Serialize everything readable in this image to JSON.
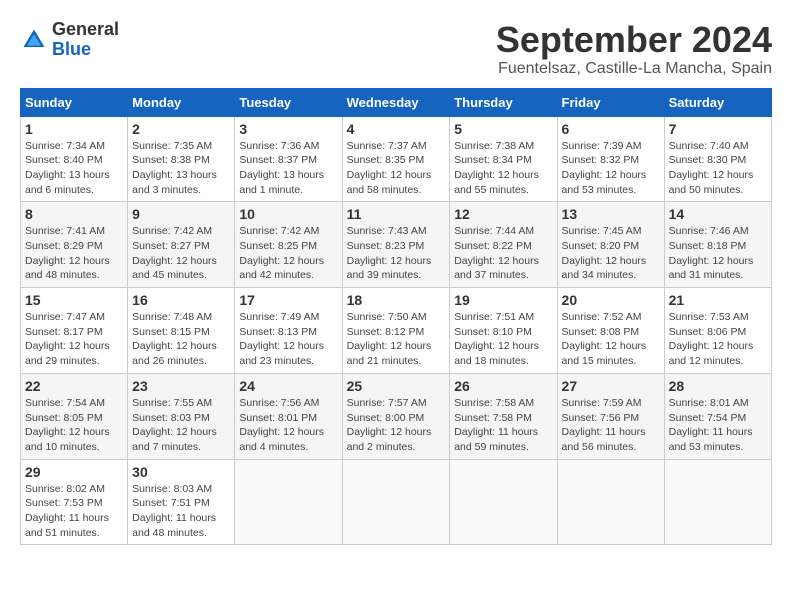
{
  "header": {
    "logo_general": "General",
    "logo_blue": "Blue",
    "month": "September 2024",
    "location": "Fuentelsaz, Castille-La Mancha, Spain"
  },
  "weekdays": [
    "Sunday",
    "Monday",
    "Tuesday",
    "Wednesday",
    "Thursday",
    "Friday",
    "Saturday"
  ],
  "weeks": [
    [
      {
        "day": "1",
        "info": "Sunrise: 7:34 AM\nSunset: 8:40 PM\nDaylight: 13 hours\nand 6 minutes."
      },
      {
        "day": "2",
        "info": "Sunrise: 7:35 AM\nSunset: 8:38 PM\nDaylight: 13 hours\nand 3 minutes."
      },
      {
        "day": "3",
        "info": "Sunrise: 7:36 AM\nSunset: 8:37 PM\nDaylight: 13 hours\nand 1 minute."
      },
      {
        "day": "4",
        "info": "Sunrise: 7:37 AM\nSunset: 8:35 PM\nDaylight: 12 hours\nand 58 minutes."
      },
      {
        "day": "5",
        "info": "Sunrise: 7:38 AM\nSunset: 8:34 PM\nDaylight: 12 hours\nand 55 minutes."
      },
      {
        "day": "6",
        "info": "Sunrise: 7:39 AM\nSunset: 8:32 PM\nDaylight: 12 hours\nand 53 minutes."
      },
      {
        "day": "7",
        "info": "Sunrise: 7:40 AM\nSunset: 8:30 PM\nDaylight: 12 hours\nand 50 minutes."
      }
    ],
    [
      {
        "day": "8",
        "info": "Sunrise: 7:41 AM\nSunset: 8:29 PM\nDaylight: 12 hours\nand 48 minutes."
      },
      {
        "day": "9",
        "info": "Sunrise: 7:42 AM\nSunset: 8:27 PM\nDaylight: 12 hours\nand 45 minutes."
      },
      {
        "day": "10",
        "info": "Sunrise: 7:42 AM\nSunset: 8:25 PM\nDaylight: 12 hours\nand 42 minutes."
      },
      {
        "day": "11",
        "info": "Sunrise: 7:43 AM\nSunset: 8:23 PM\nDaylight: 12 hours\nand 39 minutes."
      },
      {
        "day": "12",
        "info": "Sunrise: 7:44 AM\nSunset: 8:22 PM\nDaylight: 12 hours\nand 37 minutes."
      },
      {
        "day": "13",
        "info": "Sunrise: 7:45 AM\nSunset: 8:20 PM\nDaylight: 12 hours\nand 34 minutes."
      },
      {
        "day": "14",
        "info": "Sunrise: 7:46 AM\nSunset: 8:18 PM\nDaylight: 12 hours\nand 31 minutes."
      }
    ],
    [
      {
        "day": "15",
        "info": "Sunrise: 7:47 AM\nSunset: 8:17 PM\nDaylight: 12 hours\nand 29 minutes."
      },
      {
        "day": "16",
        "info": "Sunrise: 7:48 AM\nSunset: 8:15 PM\nDaylight: 12 hours\nand 26 minutes."
      },
      {
        "day": "17",
        "info": "Sunrise: 7:49 AM\nSunset: 8:13 PM\nDaylight: 12 hours\nand 23 minutes."
      },
      {
        "day": "18",
        "info": "Sunrise: 7:50 AM\nSunset: 8:12 PM\nDaylight: 12 hours\nand 21 minutes."
      },
      {
        "day": "19",
        "info": "Sunrise: 7:51 AM\nSunset: 8:10 PM\nDaylight: 12 hours\nand 18 minutes."
      },
      {
        "day": "20",
        "info": "Sunrise: 7:52 AM\nSunset: 8:08 PM\nDaylight: 12 hours\nand 15 minutes."
      },
      {
        "day": "21",
        "info": "Sunrise: 7:53 AM\nSunset: 8:06 PM\nDaylight: 12 hours\nand 12 minutes."
      }
    ],
    [
      {
        "day": "22",
        "info": "Sunrise: 7:54 AM\nSunset: 8:05 PM\nDaylight: 12 hours\nand 10 minutes."
      },
      {
        "day": "23",
        "info": "Sunrise: 7:55 AM\nSunset: 8:03 PM\nDaylight: 12 hours\nand 7 minutes."
      },
      {
        "day": "24",
        "info": "Sunrise: 7:56 AM\nSunset: 8:01 PM\nDaylight: 12 hours\nand 4 minutes."
      },
      {
        "day": "25",
        "info": "Sunrise: 7:57 AM\nSunset: 8:00 PM\nDaylight: 12 hours\nand 2 minutes."
      },
      {
        "day": "26",
        "info": "Sunrise: 7:58 AM\nSunset: 7:58 PM\nDaylight: 11 hours\nand 59 minutes."
      },
      {
        "day": "27",
        "info": "Sunrise: 7:59 AM\nSunset: 7:56 PM\nDaylight: 11 hours\nand 56 minutes."
      },
      {
        "day": "28",
        "info": "Sunrise: 8:01 AM\nSunset: 7:54 PM\nDaylight: 11 hours\nand 53 minutes."
      }
    ],
    [
      {
        "day": "29",
        "info": "Sunrise: 8:02 AM\nSunset: 7:53 PM\nDaylight: 11 hours\nand 51 minutes."
      },
      {
        "day": "30",
        "info": "Sunrise: 8:03 AM\nSunset: 7:51 PM\nDaylight: 11 hours\nand 48 minutes."
      },
      {
        "day": "",
        "info": ""
      },
      {
        "day": "",
        "info": ""
      },
      {
        "day": "",
        "info": ""
      },
      {
        "day": "",
        "info": ""
      },
      {
        "day": "",
        "info": ""
      }
    ]
  ]
}
